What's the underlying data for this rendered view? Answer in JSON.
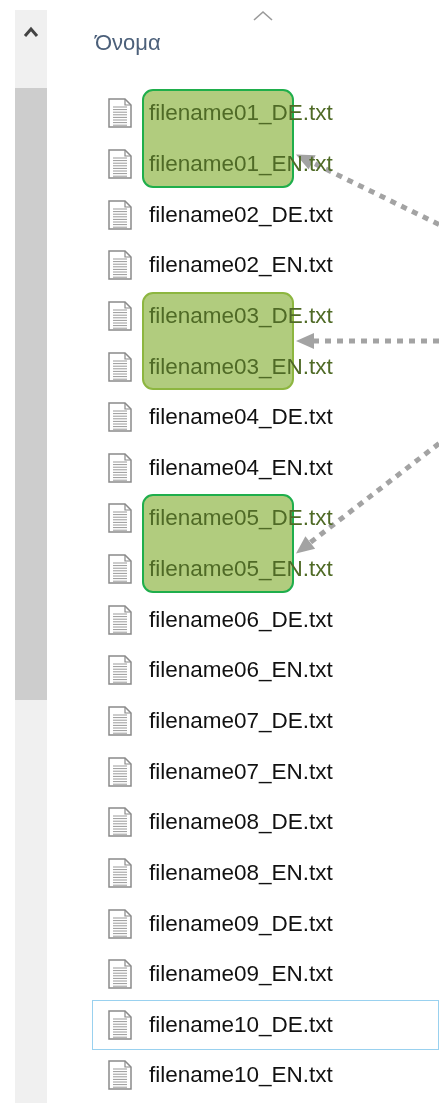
{
  "column_header": {
    "label": "Όνομα",
    "sort_ascending": true
  },
  "files": [
    {
      "name": "filename01_DE.txt",
      "focused": false,
      "highlighted": true,
      "color": "#1fae4b"
    },
    {
      "name": "filename01_EN.txt",
      "focused": false,
      "highlighted": true,
      "color": "#1fae4b"
    },
    {
      "name": "filename02_DE.txt",
      "focused": false,
      "highlighted": false
    },
    {
      "name": "filename02_EN.txt",
      "focused": false,
      "highlighted": false
    },
    {
      "name": "filename03_DE.txt",
      "focused": false,
      "highlighted": true,
      "color": "#8db640"
    },
    {
      "name": "filename03_EN.txt",
      "focused": false,
      "highlighted": true,
      "color": "#8db640"
    },
    {
      "name": "filename04_DE.txt",
      "focused": false,
      "highlighted": false
    },
    {
      "name": "filename04_EN.txt",
      "focused": false,
      "highlighted": false
    },
    {
      "name": "filename05_DE.txt",
      "focused": false,
      "highlighted": true,
      "color": "#1fae4c"
    },
    {
      "name": "filename05_EN.txt",
      "focused": false,
      "highlighted": true,
      "color": "#1fae4c"
    },
    {
      "name": "filename06_DE.txt",
      "focused": false,
      "highlighted": false
    },
    {
      "name": "filename06_EN.txt",
      "focused": false,
      "highlighted": false
    },
    {
      "name": "filename07_DE.txt",
      "focused": false,
      "highlighted": false
    },
    {
      "name": "filename07_EN.txt",
      "focused": false,
      "highlighted": false
    },
    {
      "name": "filename08_DE.txt",
      "focused": false,
      "highlighted": false
    },
    {
      "name": "filename08_EN.txt",
      "focused": false,
      "highlighted": false
    },
    {
      "name": "filename09_DE.txt",
      "focused": false,
      "highlighted": false
    },
    {
      "name": "filename09_EN.txt",
      "focused": false,
      "highlighted": false
    },
    {
      "name": "filename10_DE.txt",
      "focused": true,
      "highlighted": false
    },
    {
      "name": "filename10_EN.txt",
      "focused": false,
      "highlighted": false
    }
  ]
}
